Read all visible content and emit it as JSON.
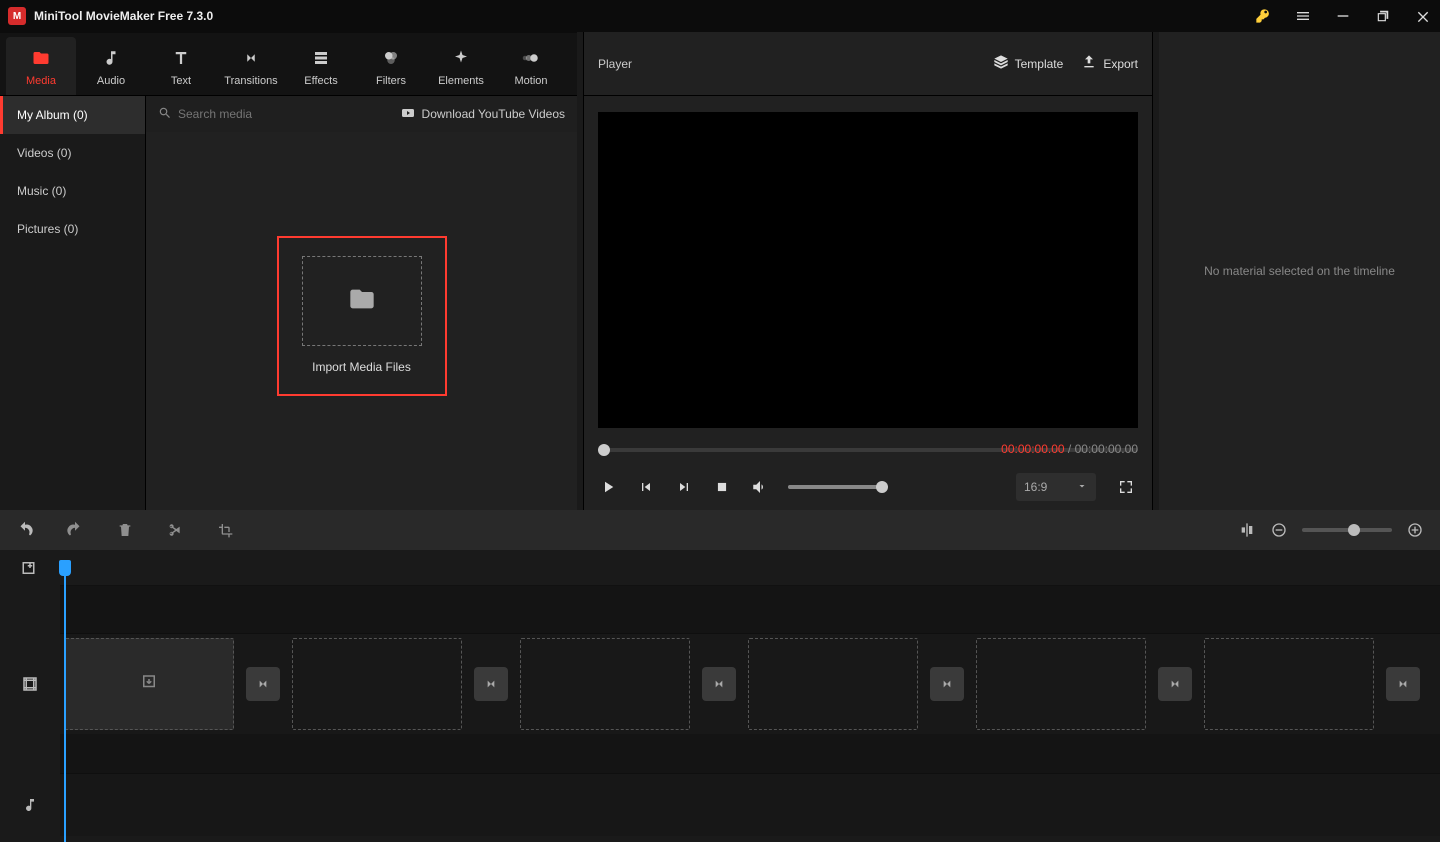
{
  "title_bar": {
    "app_title": "MiniTool MovieMaker Free 7.3.0"
  },
  "tabs": {
    "media": "Media",
    "audio": "Audio",
    "text": "Text",
    "transitions": "Transitions",
    "effects": "Effects",
    "filters": "Filters",
    "elements": "Elements",
    "motion": "Motion"
  },
  "media_sidebar": {
    "my_album": "My Album (0)",
    "videos": "Videos (0)",
    "music": "Music (0)",
    "pictures": "Pictures (0)"
  },
  "media_toolbar": {
    "search_placeholder": "Search media",
    "download_yt": "Download YouTube Videos"
  },
  "import_card": {
    "label": "Import Media Files"
  },
  "player": {
    "title": "Player",
    "template": "Template",
    "export": "Export",
    "time_current": "00:00:00.00",
    "time_sep": " / ",
    "time_total": "00:00:00.00",
    "aspect": "16:9"
  },
  "properties": {
    "empty": "No material selected on the timeline"
  }
}
